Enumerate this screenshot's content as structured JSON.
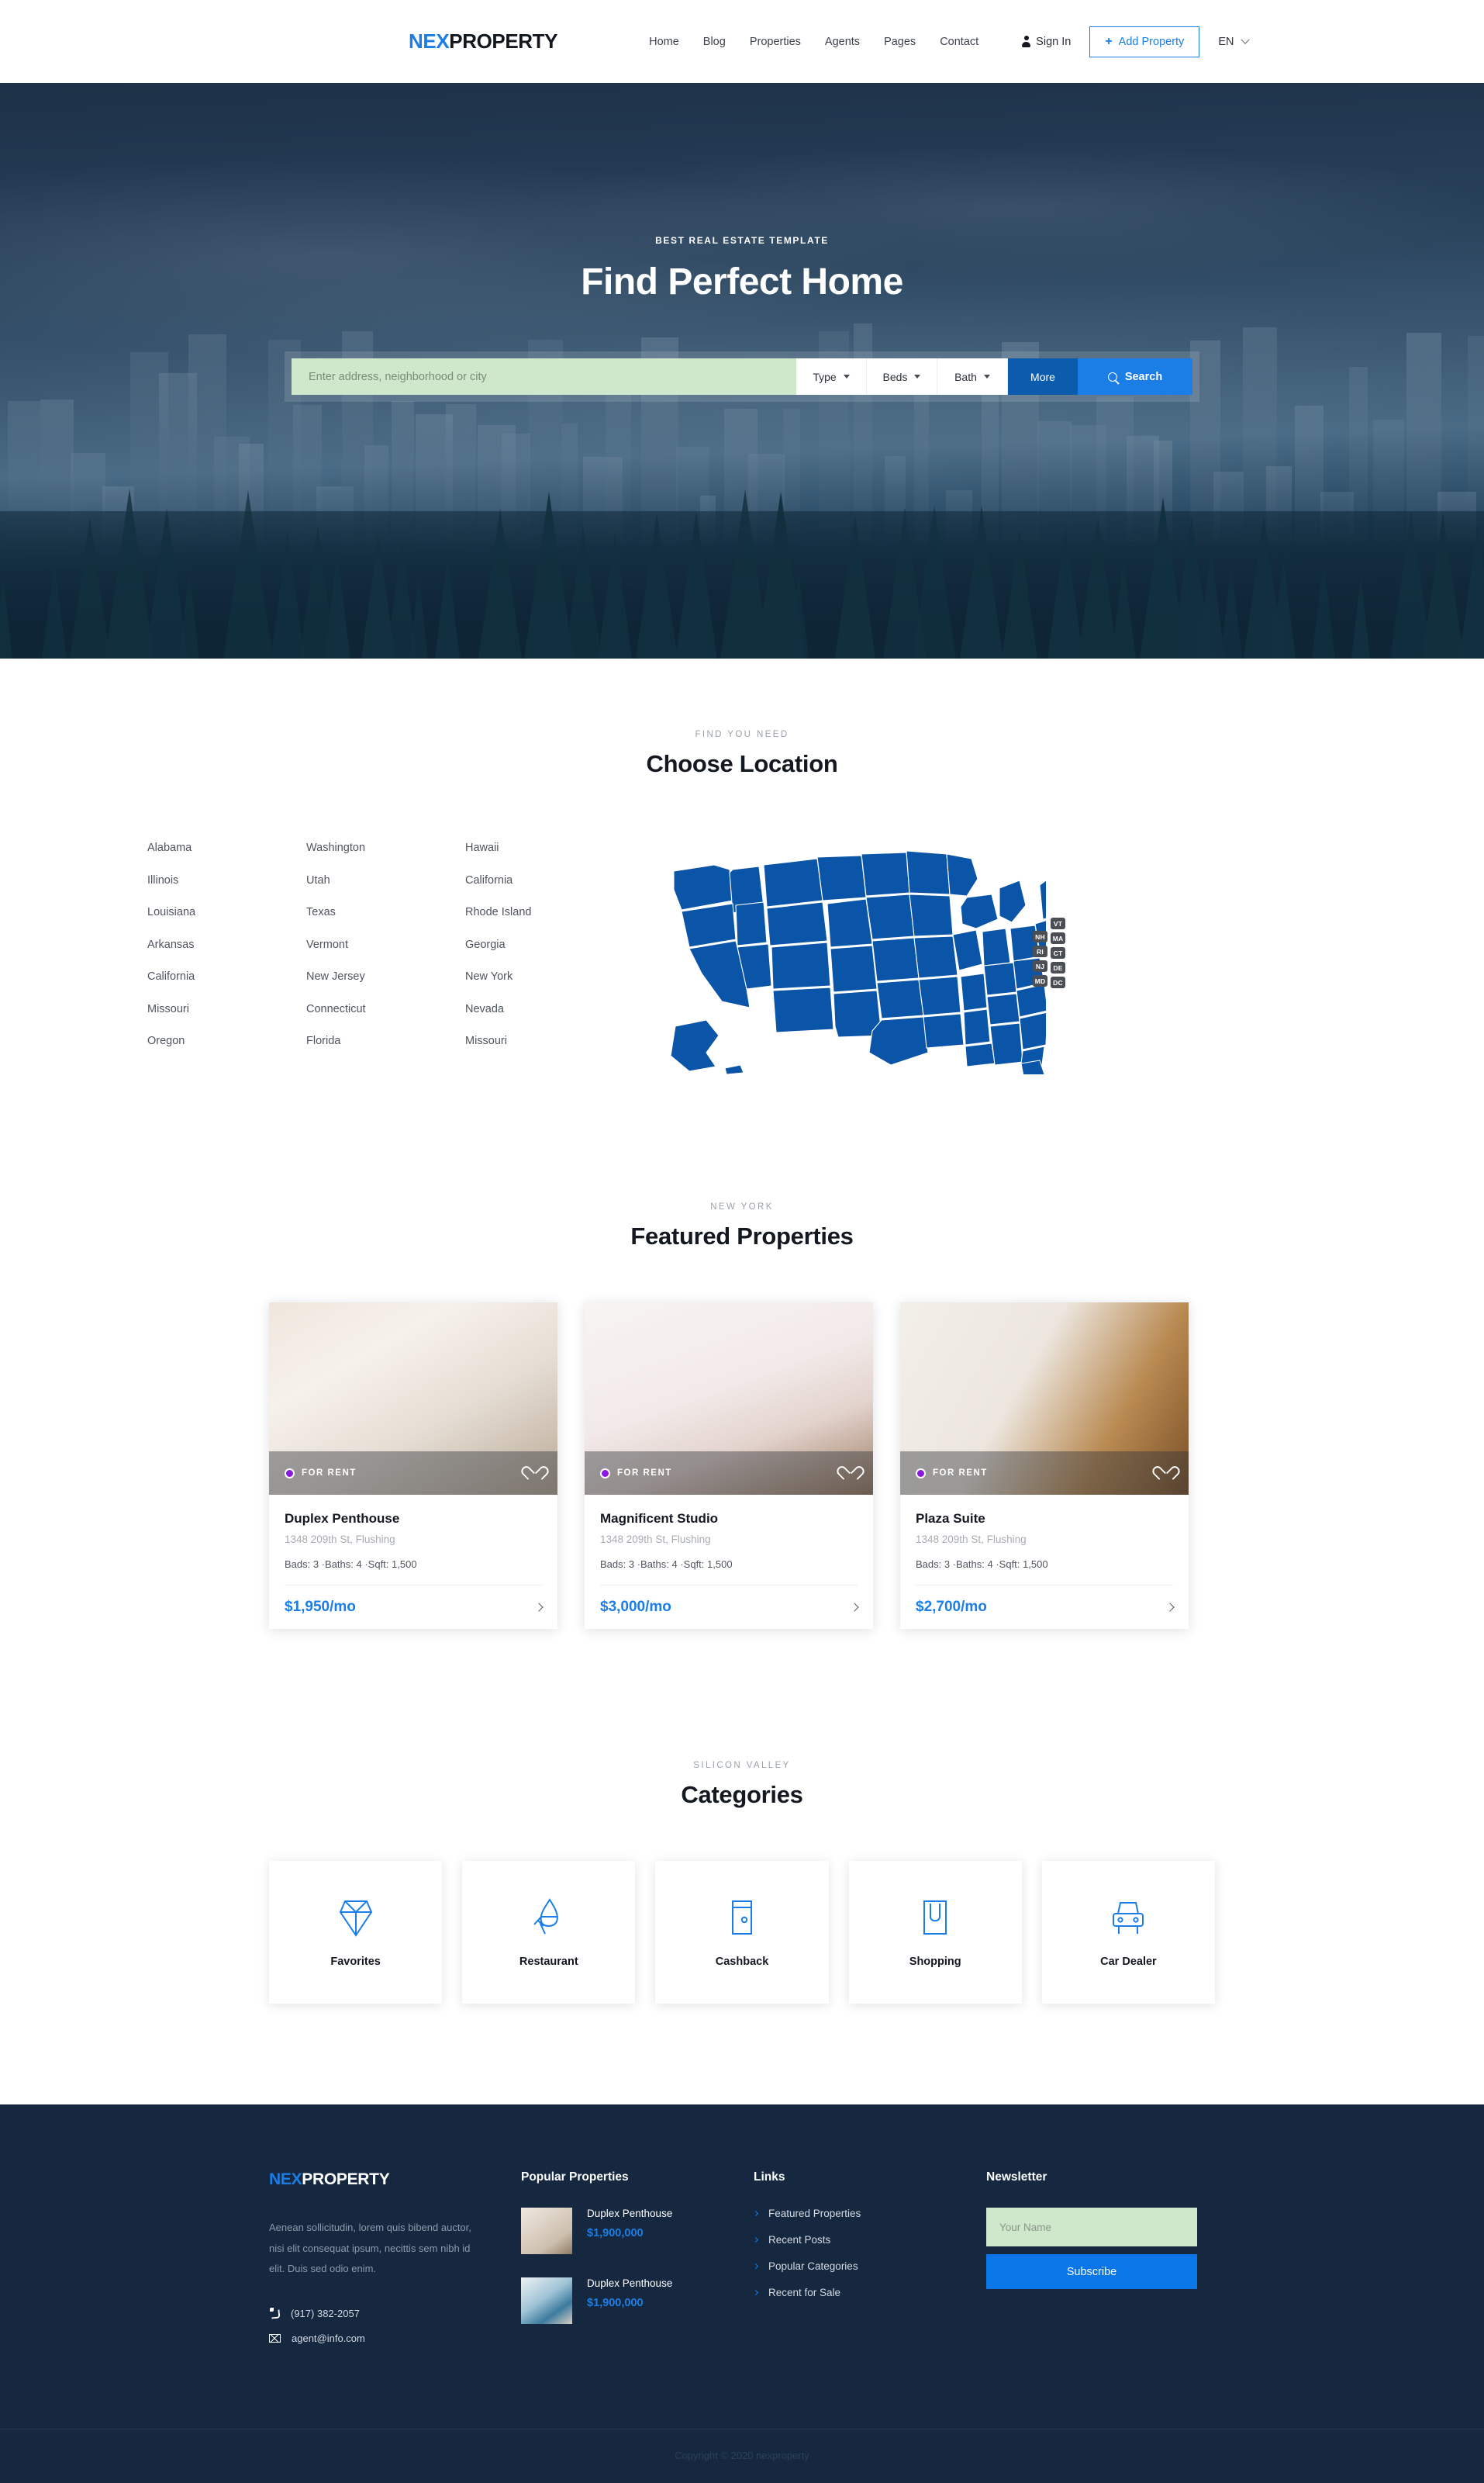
{
  "header": {
    "logo_nex": "NEX",
    "logo_property": "PROPERTY",
    "nav": [
      {
        "label": "Home"
      },
      {
        "label": "Blog"
      },
      {
        "label": "Properties"
      },
      {
        "label": "Agents"
      },
      {
        "label": "Pages"
      },
      {
        "label": "Contact"
      }
    ],
    "sign_in": "Sign In",
    "add_property": "Add Property",
    "add_property_plus": "+",
    "language": "EN"
  },
  "hero": {
    "eyebrow": "BEST REAL ESTATE TEMPLATE",
    "title": "Find Perfect Home",
    "search": {
      "placeholder": "Enter address, neighborhood or city",
      "value": "",
      "type_label": "Type",
      "beds_label": "Beds",
      "bath_label": "Bath",
      "more_label": "More",
      "search_label": "Search"
    }
  },
  "locations": {
    "eyebrow": "FIND YOU NEED",
    "title": "Choose Location",
    "columns": [
      [
        "Alabama",
        "Illinois",
        "Louisiana",
        "Arkansas",
        "California",
        "Missouri",
        "Oregon"
      ],
      [
        "Washington",
        "Utah",
        "Texas",
        "Vermont",
        "New Jersey",
        "Connecticut",
        "Florida"
      ],
      [
        "Hawaii",
        "California",
        "Rhode Island",
        "Georgia",
        "New York",
        "Nevada",
        "Missouri"
      ]
    ],
    "map": {
      "fill_color": "#0b55a8",
      "abbr_left": [
        "NH",
        "RI",
        "NJ",
        "MD"
      ],
      "abbr_right": [
        "VT",
        "MA",
        "CT",
        "DE",
        "DC"
      ]
    }
  },
  "featured": {
    "eyebrow": "NEW YORK",
    "title": "Featured Properties",
    "badge_label": "FOR RENT",
    "cards": [
      {
        "title": "Duplex Penthouse",
        "address": "1348 209th St, Flushing",
        "meta": "Bads: 3  ·Baths: 4  ·Sqft: 1,500",
        "price": "$1,950/mo"
      },
      {
        "title": "Magnificent Studio",
        "address": "1348 209th St, Flushing",
        "meta": "Bads: 3  ·Baths: 4  ·Sqft: 1,500",
        "price": "$3,000/mo"
      },
      {
        "title": "Plaza Suite",
        "address": "1348 209th St, Flushing",
        "meta": "Bads: 3  ·Baths: 4  ·Sqft: 1,500",
        "price": "$2,700/mo"
      }
    ]
  },
  "categories": {
    "eyebrow": "SILICON VALLEY",
    "title": "Categories",
    "accent_color": "#1a7ee6",
    "items": [
      {
        "label": "Favorites",
        "icon": "diamond-icon"
      },
      {
        "label": "Restaurant",
        "icon": "wine-glass-icon"
      },
      {
        "label": "Cashback",
        "icon": "wallet-icon"
      },
      {
        "label": "Shopping",
        "icon": "shopping-bag-icon"
      },
      {
        "label": "Car Dealer",
        "icon": "car-icon"
      }
    ]
  },
  "footer": {
    "logo_nex": "NEX",
    "logo_property": "PROPERTY",
    "description": "Aenean sollicitudin, lorem quis bibend auctor, nisi elit consequat ipsum, necittis sem nibh id elit. Duis sed odio enim.",
    "phone": "(917) 382-2057",
    "email": "agent@info.com",
    "popular": {
      "title": "Popular Properties",
      "items": [
        {
          "name": "Duplex Penthouse",
          "price": "$1,900,000"
        },
        {
          "name": "Duplex Penthouse",
          "price": "$1,900,000"
        }
      ]
    },
    "links": {
      "title": "Links",
      "items": [
        "Featured Properties",
        "Recent Posts",
        "Popular Categories",
        "Recent for Sale"
      ]
    },
    "newsletter": {
      "title": "Newsletter",
      "placeholder": "Your Name",
      "value": "",
      "button": "Subscribe"
    },
    "copyright": "Copyright © 2020 nexproperty"
  }
}
